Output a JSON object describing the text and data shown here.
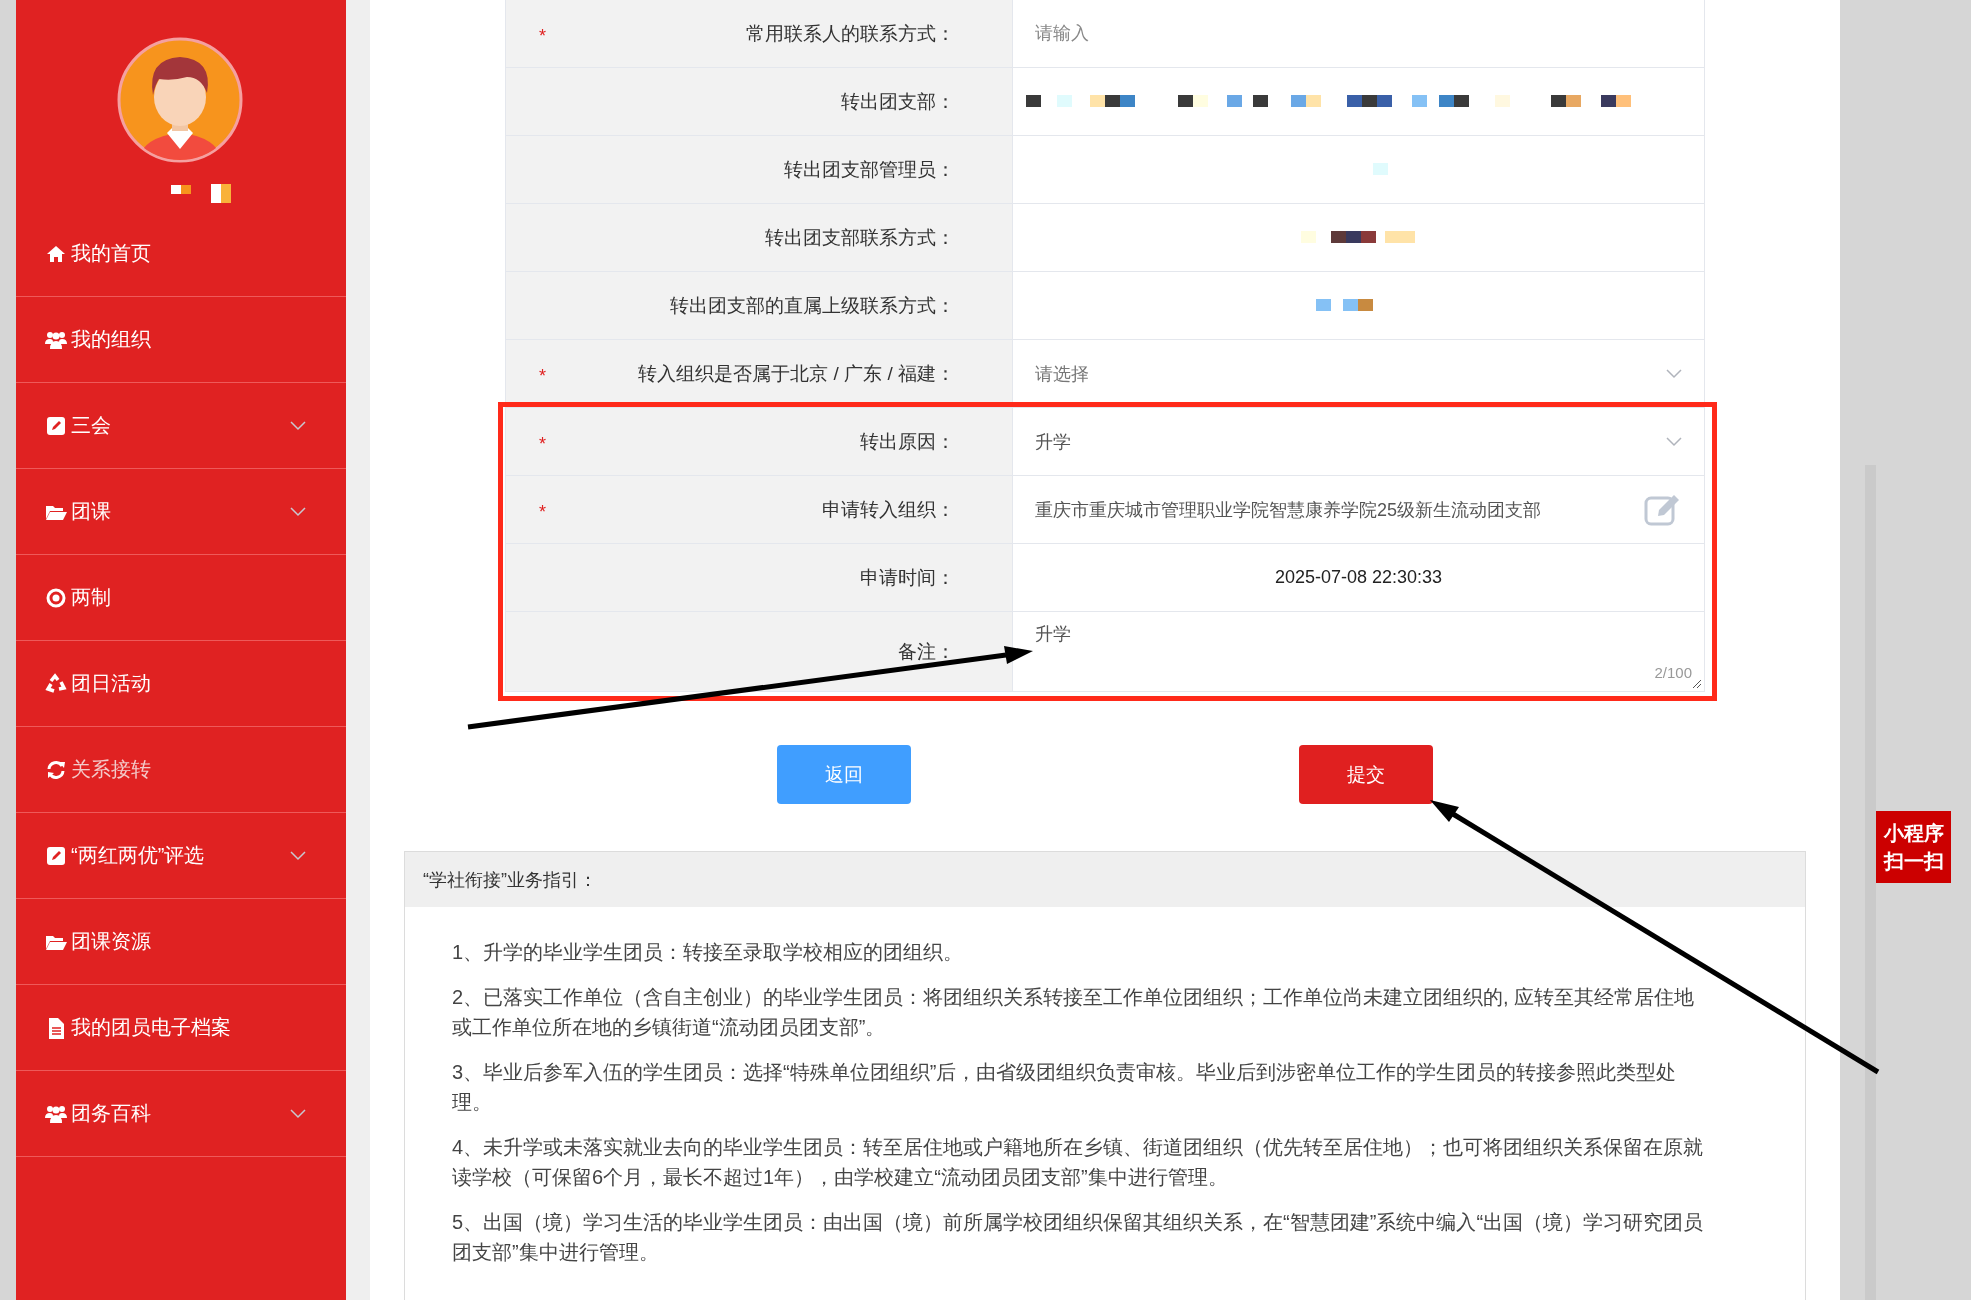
{
  "sidebar": {
    "items": [
      {
        "label": "我的首页",
        "expandable": false,
        "selected": false
      },
      {
        "label": "我的组织",
        "expandable": false,
        "selected": false
      },
      {
        "label": "三会",
        "expandable": true,
        "selected": false
      },
      {
        "label": "团课",
        "expandable": true,
        "selected": false
      },
      {
        "label": "两制",
        "expandable": false,
        "selected": false
      },
      {
        "label": "团日活动",
        "expandable": false,
        "selected": false
      },
      {
        "label": "关系接转",
        "expandable": false,
        "selected": true
      },
      {
        "label": "“两红两优”评选",
        "expandable": true,
        "selected": false
      },
      {
        "label": "团课资源",
        "expandable": false,
        "selected": false
      },
      {
        "label": "我的团员电子档案",
        "expandable": false,
        "selected": false
      },
      {
        "label": "团务百科",
        "expandable": true,
        "selected": false
      }
    ]
  },
  "form": {
    "rows": [
      {
        "label": "常用联系人的联系方式：",
        "required_mark": "*",
        "kind": "input",
        "placeholder": "请输入"
      },
      {
        "label": "转出团支部：",
        "kind": "redacted"
      },
      {
        "label": "转出团支部管理员：",
        "kind": "redacted"
      },
      {
        "label": "转出团支部联系方式：",
        "kind": "redacted"
      },
      {
        "label": "转出团支部的直属上级联系方式：",
        "kind": "redacted"
      },
      {
        "label": "转入组织是否属于北京 / 广东 / 福建：",
        "required_mark": "*",
        "kind": "select",
        "placeholder": "请选择"
      },
      {
        "label": "转出原因：",
        "required_mark": "*",
        "kind": "select",
        "value": "升学"
      },
      {
        "label": "申请转入组织：",
        "required_mark": "*",
        "kind": "picker",
        "value": "重庆市重庆城市管理职业学院智慧康养学院25级新生流动团支部"
      },
      {
        "label": "申请时间：",
        "kind": "text",
        "value": "2025-07-08 22:30:33"
      },
      {
        "label": "备注：",
        "kind": "textarea",
        "value": "升学",
        "counter": "2/100"
      }
    ]
  },
  "buttons": [
    {
      "label": "返回",
      "kind": "secondary"
    },
    {
      "label": "提交",
      "kind": "primary"
    }
  ],
  "guide": {
    "title": "“学社衔接”业务指引：",
    "items": [
      "1、升学的毕业学生团员：转接至录取学校相应的团组织。",
      "2、已落实工作单位（含自主创业）的毕业学生团员：将团组织关系转接至工作单位团组织；工作单位尚未建立团组织的, 应转至其经常居住地或工作单位所在地的乡镇街道“流动团员团支部”。",
      "3、毕业后参军入伍的学生团员：选择“特殊单位团组织”后，由省级团组织负责审核。毕业后到涉密单位工作的学生团员的转接参照此类型处理。",
      "4、未升学或未落实就业去向的毕业学生团员：转至居住地或户籍地所在乡镇、街道团组织（优先转至居住地）；也可将团组织关系保留在原就读学校（可保留6个月，最长不超过1年），由学校建立“流动团员团支部”集中进行管理。",
      "5、出国（境）学习生活的毕业学生团员：由出国（境）前所属学校团组织保留其组织关系，在“智慧团建”系统中编入“出国（境）学习研究团员团支部”集中进行管理。"
    ]
  },
  "floating_badge": {
    "lines": [
      "小程序",
      "扫一扫"
    ]
  },
  "annotations": [
    {
      "kind": "highlight-box"
    },
    {
      "kind": "arrow"
    },
    {
      "kind": "arrow"
    }
  ]
}
